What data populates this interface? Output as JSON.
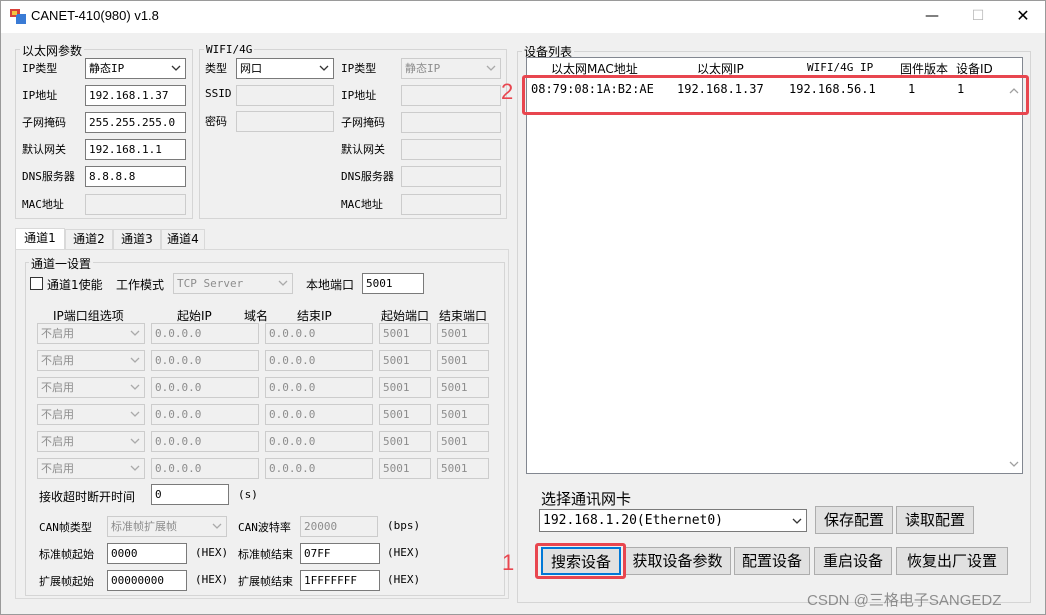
{
  "window": {
    "title": "CANET-410(980) v1.8",
    "minimize": "—",
    "maximize": "☐",
    "close": "✕"
  },
  "eth": {
    "group_label": "以太网参数",
    "ip_type_label": "IP类型",
    "ip_type_value": "静态IP",
    "ip_label": "IP地址",
    "ip_value": "192.168.1.37",
    "mask_label": "子网掩码",
    "mask_value": "255.255.255.0",
    "gateway_label": "默认网关",
    "gateway_value": "192.168.1.1",
    "dns_label": "DNS服务器",
    "dns_value": "8.8.8.8",
    "mac_label": "MAC地址",
    "mac_value": ""
  },
  "wifi": {
    "group_label": "WIFI/4G",
    "type_label": "类型",
    "type_value": "网口",
    "ssid_label": "SSID",
    "password_label": "密码",
    "ip_type_label": "IP类型",
    "ip_type_value": "静态IP",
    "ip_label": "IP地址",
    "mask_label": "子网掩码",
    "gateway_label": "默认网关",
    "dns_label": "DNS服务器",
    "mac_label": "MAC地址"
  },
  "tabs": [
    "通道1",
    "通道2",
    "通道3",
    "通道4"
  ],
  "channel": {
    "group_label": "通道一设置",
    "enable_label": "通道1使能",
    "mode_label": "工作模式",
    "mode_value": "TCP Server",
    "local_port_label": "本地端口",
    "local_port_value": "5001",
    "col_ip_group": "IP端口组选项",
    "col_start_ip": "起始IP",
    "col_domain": "域名",
    "col_end_ip": "结束IP",
    "col_start_port": "起始端口",
    "col_end_port": "结束端口",
    "rows": [
      {
        "option": "不启用",
        "start_ip": "0.0.0.0",
        "end_ip": "0.0.0.0",
        "start_port": "5001",
        "end_port": "5001"
      },
      {
        "option": "不启用",
        "start_ip": "0.0.0.0",
        "end_ip": "0.0.0.0",
        "start_port": "5001",
        "end_port": "5001"
      },
      {
        "option": "不启用",
        "start_ip": "0.0.0.0",
        "end_ip": "0.0.0.0",
        "start_port": "5001",
        "end_port": "5001"
      },
      {
        "option": "不启用",
        "start_ip": "0.0.0.0",
        "end_ip": "0.0.0.0",
        "start_port": "5001",
        "end_port": "5001"
      },
      {
        "option": "不启用",
        "start_ip": "0.0.0.0",
        "end_ip": "0.0.0.0",
        "start_port": "5001",
        "end_port": "5001"
      },
      {
        "option": "不启用",
        "start_ip": "0.0.0.0",
        "end_ip": "0.0.0.0",
        "start_port": "5001",
        "end_port": "5001"
      }
    ],
    "timeout_label": "接收超时断开时间",
    "timeout_value": "0",
    "timeout_unit": "(s)",
    "can_frame_label": "CAN帧类型",
    "can_frame_value": "标准帧扩展帧",
    "can_baud_label": "CAN波特率",
    "can_baud_value": "20000",
    "can_baud_unit": "(bps)",
    "std_start_label": "标准帧起始",
    "std_start_value": "0000",
    "std_end_label": "标准帧结束",
    "std_end_value": "07FF",
    "ext_start_label": "扩展帧起始",
    "ext_start_value": "00000000",
    "ext_end_label": "扩展帧结束",
    "ext_end_value": "1FFFFFFF",
    "hex_unit": "(HEX)"
  },
  "device_list": {
    "group_label": "设备列表",
    "headers": [
      "以太网MAC地址",
      "以太网IP",
      "WIFI/4G IP",
      "固件版本",
      "设备ID"
    ],
    "rows": [
      {
        "mac": "08:79:08:1A:B2:AE",
        "ip": "192.168.1.37",
        "wifi_ip": "192.168.56.1",
        "firmware": "1",
        "device_id": "1"
      }
    ]
  },
  "nic": {
    "label": "选择通讯网卡",
    "value": "192.168.1.20(Ethernet0)"
  },
  "buttons": {
    "save_config": "保存配置",
    "read_config": "读取配置",
    "search": "搜索设备",
    "get_params": "获取设备参数",
    "configure": "配置设备",
    "restart": "重启设备",
    "factory_reset": "恢复出厂设置"
  },
  "annotations": {
    "marker_1": "1",
    "marker_2": "2"
  },
  "watermark": "CSDN @三格电子SANGEDZ",
  "colors": {
    "highlight_red": "#e8464f",
    "window_bg": "#f0f0f0"
  }
}
